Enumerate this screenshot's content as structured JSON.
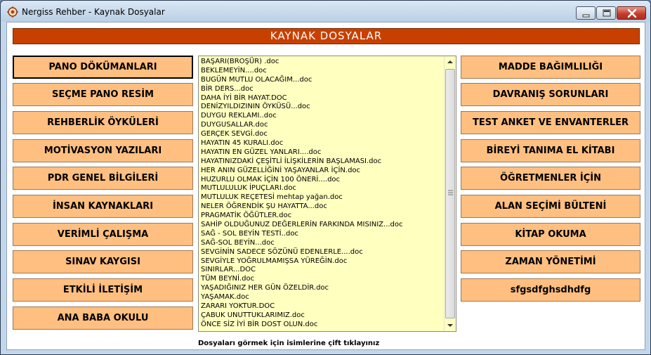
{
  "window": {
    "title": "Nergiss Rehber - Kaynak Dosyalar"
  },
  "header": {
    "title": "KAYNAK DOSYALAR"
  },
  "left_buttons": [
    "PANO DÖKÜMANLARI",
    "SEÇME PANO RESİM",
    "REHBERLİK ÖYKÜLERİ",
    "MOTİVASYON YAZILARI",
    "PDR GENEL BİLGİLERİ",
    "İNSAN KAYNAKLARI",
    "VERİMLİ ÇALIŞMA",
    "SINAV KAYGISI",
    "ETKİLİ İLETİŞİM",
    "ANA BABA OKULU"
  ],
  "right_buttons": [
    "MADDE BAĞIMLILIĞI",
    "DAVRANIŞ SORUNLARI",
    "TEST ANKET VE ENVANTERLER",
    "BİREYİ TANIMA EL KİTABI",
    "ÖĞRETMENLER İÇİN",
    "ALAN SEÇİMİ BÜLTENİ",
    "KİTAP OKUMA",
    "ZAMAN YÖNETİMİ",
    "sfgsdfghsdhdfg"
  ],
  "file_list": [
    "BAŞARI(BROŞÜR) .doc",
    "BEKLEMEYİN....doc",
    "BUGÜN MUTLU OLACAĞIM...doc",
    "BİR DERS...doc",
    "DAHA İYİ BİR HAYAT.DOC",
    "DENİZYILDIZININ ÖYKÜSÜ...doc",
    "DUYGU REKLAMI..doc",
    "DUYGUSALLAR.doc",
    "GERÇEK SEVGİ.doc",
    "HAYATIN 45 KURALI.doc",
    "HAYATIN EN GÜZEL YANLARI....doc",
    "HAYATINIZDAKİ ÇEŞİTLİ İLİŞKİLERİN BAŞLAMASI.doc",
    "HER ANIN GÜZELLİĞİNİ YAŞAYANLAR İÇİN.doc",
    "HUZURLU OLMAK İÇİN 100 ÖNERİ....doc",
    "MUTLULULUK İPUÇLARI.doc",
    "MUTLULUK REÇETESİ mehtap yağan.doc",
    "NELER ÖĞRENDİK ŞU HAYATTA...doc",
    "PRAGMATİK ÖĞÜTLER.doc",
    "SAHİP OLDUĞUNUZ DEĞERLERİN FARKINDA MISINIZ...doc",
    "SAĞ - SOL BEYİN TESTİ..doc",
    "SAĞ-SOL BEYİN...doc",
    "SEVGİNİN SADECE SÖZÜNÜ EDENLERLE....doc",
    "SEVGİYLE YOĞRULMAMIŞSA YÜREĞİN.doc",
    "SINIRLAR...DOC",
    "TÜM BEYNİ.doc",
    "YAŞADIĞINIZ HER GÜN ÖZELDİR.doc",
    "YAŞAMAK.doc",
    "ZARARI YOKTUR.DOC",
    "ÇABUK UNUTTUKLARIMIZ.doc",
    "ÖNCE SİZ İYİ BİR DOST OLUN.doc"
  ],
  "footer": {
    "hint": "Dosyaları görmek için isimlerine çift tıklayınız"
  },
  "colors": {
    "header_bg": "#c84000",
    "button_bg": "#ffbf80",
    "list_bg": "#ffffc0",
    "window_bg": "#c4d6ea"
  },
  "icons": {
    "app": "app-icon",
    "minimize": "minimize-icon",
    "maximize": "maximize-icon",
    "close": "close-icon"
  }
}
